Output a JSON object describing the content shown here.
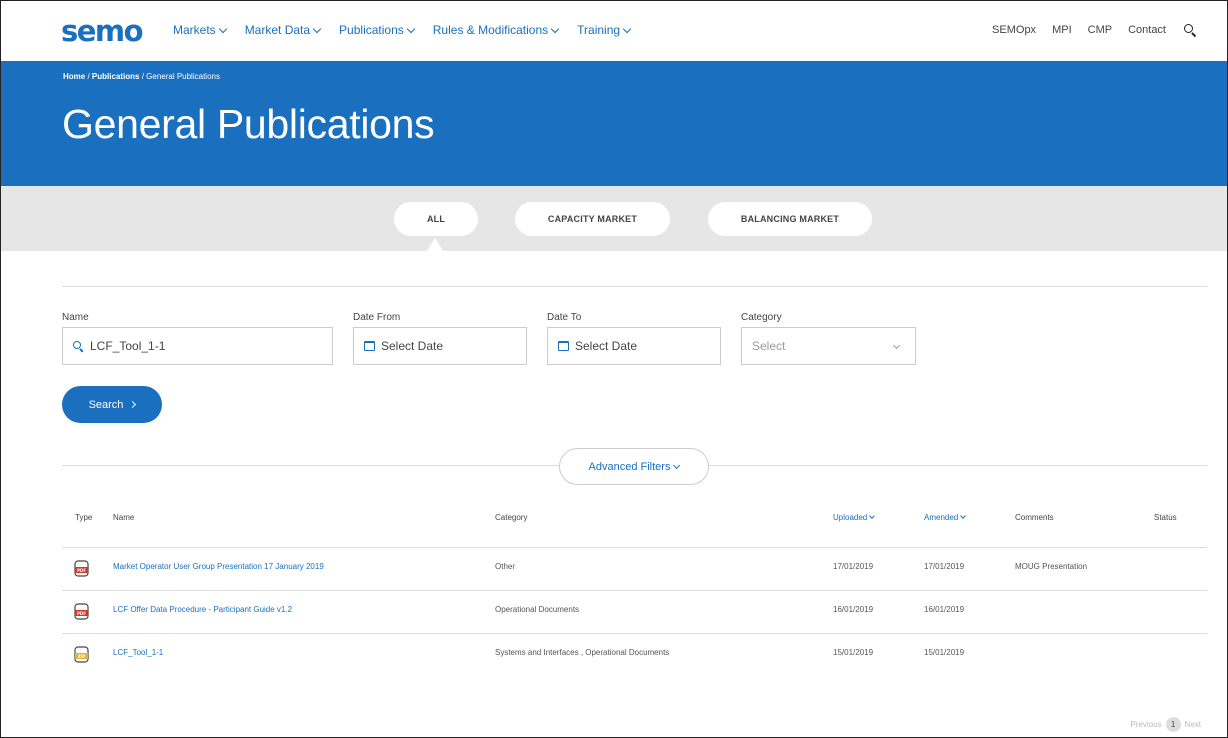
{
  "header": {
    "logo": "semo",
    "nav": [
      {
        "label": "Markets",
        "dropdown": true
      },
      {
        "label": "Market Data",
        "dropdown": true
      },
      {
        "label": "Publications",
        "dropdown": true
      },
      {
        "label": "Rules & Modifications",
        "dropdown": true
      },
      {
        "label": "Training",
        "dropdown": true
      }
    ],
    "right_links": [
      "SEMOpx",
      "MPI",
      "CMP",
      "Contact"
    ],
    "search_icon": "search-icon"
  },
  "hero": {
    "breadcrumb": [
      "Home",
      "Publications",
      "General Publications"
    ],
    "title": "General Publications"
  },
  "tabs": [
    {
      "label": "ALL",
      "active": true
    },
    {
      "label": "CAPACITY MARKET",
      "active": false
    },
    {
      "label": "BALANCING MARKET",
      "active": false
    }
  ],
  "filters": {
    "name_label": "Name",
    "name_value": "LCF_Tool_1-1",
    "date_from_label": "Date From",
    "date_from_placeholder": "Select Date",
    "date_to_label": "Date To",
    "date_to_placeholder": "Select Date",
    "category_label": "Category",
    "category_placeholder": "Select",
    "search_button": "Search",
    "advanced_filters": "Advanced Filters"
  },
  "table": {
    "columns": [
      "Type",
      "Name",
      "Category",
      "Uploaded",
      "Amended",
      "Comments",
      "Status"
    ],
    "rows": [
      {
        "type": "PDF",
        "name": "Market Operator User Group Presentation 17 January 2019",
        "category": "Other",
        "uploaded": "17/01/2019",
        "amended": "17/01/2019",
        "comments": "MOUG Presentation",
        "status": ""
      },
      {
        "type": "PDF",
        "name": "LCF Offer Data Procedure - Participant Guide v1.2",
        "category": "Operational Documents",
        "uploaded": "16/01/2019",
        "amended": "16/01/2019",
        "comments": "",
        "status": ""
      },
      {
        "type": "ZIP",
        "name": "LCF_Tool_1-1",
        "category": "Systems and Interfaces , Operational Documents",
        "uploaded": "15/01/2019",
        "amended": "15/01/2019",
        "comments": "",
        "status": ""
      }
    ]
  },
  "pagination": {
    "previous": "Previous",
    "current": "1",
    "next": "Next"
  },
  "colors": {
    "brand": "#1a6fbf",
    "pdf_icon": "#d9342b",
    "zip_icon": "#e0b43a"
  }
}
